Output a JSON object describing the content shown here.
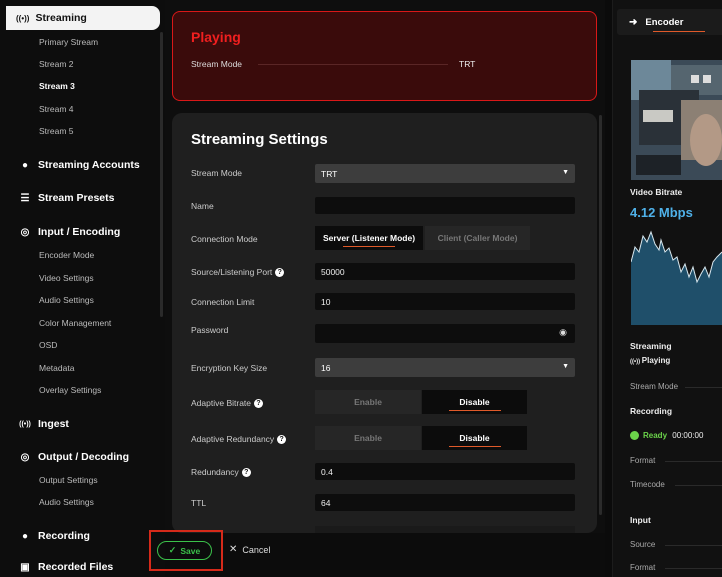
{
  "sidebar": {
    "active_label": "Streaming",
    "streaming_items": [
      "Primary Stream",
      "Stream 2",
      "Stream 3",
      "Stream 4",
      "Stream 5"
    ],
    "active_stream": "Stream 3",
    "sections": {
      "streaming_accounts": "Streaming Accounts",
      "stream_presets": "Stream Presets",
      "input_encoding": "Input / Encoding",
      "ingest": "Ingest",
      "output_decoding": "Output / Decoding",
      "recording": "Recording",
      "recorded_files": "Recorded Files"
    },
    "input_encoding_items": [
      "Encoder Mode",
      "Video Settings",
      "Audio Settings",
      "Color Management",
      "OSD",
      "Metadata",
      "Overlay Settings"
    ],
    "output_decoding_items": [
      "Output Settings",
      "Audio Settings"
    ]
  },
  "status": {
    "title": "Playing",
    "stream_mode_label": "Stream Mode",
    "stream_mode_value": "TRT"
  },
  "settings": {
    "title": "Streaming Settings",
    "stream_mode_label": "Stream Mode",
    "stream_mode_value": "TRT",
    "name_label": "Name",
    "name_value": "",
    "connection_mode_label": "Connection Mode",
    "connection_mode_options": [
      "Server (Listener Mode)",
      "Client (Caller Mode)"
    ],
    "port_label": "Source/Listening Port",
    "port_value": "50000",
    "conn_limit_label": "Connection Limit",
    "conn_limit_value": "10",
    "password_label": "Password",
    "password_value": "",
    "enc_key_label": "Encryption Key Size",
    "enc_key_value": "16",
    "adaptive_bitrate_label": "Adaptive Bitrate",
    "adaptive_redundancy_label": "Adaptive Redundancy",
    "enable_label": "Enable",
    "disable_label": "Disable",
    "redundancy_label": "Redundancy",
    "redundancy_value": "0.4",
    "ttl_label": "TTL",
    "ttl_value": "64",
    "help_glyph": "?"
  },
  "footer": {
    "save_label": "Save",
    "cancel_label": "Cancel"
  },
  "right_panel": {
    "tab_label": "Encoder",
    "video_bitrate_label": "Video Bitrate",
    "video_bitrate_value": "4.12 Mbps",
    "streaming_label": "Streaming",
    "streaming_status": "Playing",
    "stream_mode_label": "Stream Mode",
    "recording_label": "Recording",
    "recording_status": "Ready",
    "recording_time": "00:00:00",
    "format_label": "Format",
    "timecode_label": "Timecode",
    "input_label": "Input",
    "source_label": "Source",
    "input_format_label": "Format"
  },
  "colors": {
    "accent_red": "#d91818",
    "save_green": "#3bc14a",
    "bitrate_blue": "#4fb1e9",
    "tab_underline": "#e05a2a"
  }
}
